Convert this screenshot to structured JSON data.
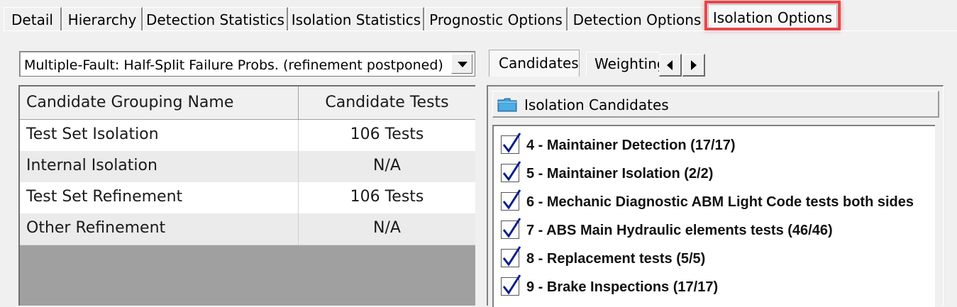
{
  "tabs": [
    {
      "label": "Detail"
    },
    {
      "label": "Hierarchy"
    },
    {
      "label": "Detection Statistics"
    },
    {
      "label": "Isolation Statistics"
    },
    {
      "label": "Prognostic Options"
    },
    {
      "label": "Detection Options"
    },
    {
      "label": "Isolation Options"
    }
  ],
  "active_tab": "Isolation Options",
  "strategy_select": {
    "value": "Multiple-Fault: Half-Split Failure Probs. (refinement postponed)"
  },
  "grid": {
    "columns": [
      "Candidate Grouping Name",
      "Candidate Tests"
    ],
    "rows": [
      {
        "name": "Test Set Isolation",
        "tests": "106 Tests"
      },
      {
        "name": "Internal Isolation",
        "tests": "N/A"
      },
      {
        "name": "Test Set Refinement",
        "tests": "106 Tests"
      },
      {
        "name": "Other Refinement",
        "tests": "N/A"
      }
    ]
  },
  "subtabs": [
    {
      "label": "Candidates"
    },
    {
      "label": "Weighting"
    }
  ],
  "candidates_panel": {
    "title": "Isolation Candidates",
    "items": [
      {
        "label": "4 - Maintainer Detection (17/17)",
        "checked": true
      },
      {
        "label": "5 - Maintainer Isolation (2/2)",
        "checked": true
      },
      {
        "label": "6 - Mechanic Diagnostic ABM Light Code tests both sides",
        "checked": true
      },
      {
        "label": "7 - ABS Main Hydraulic elements tests (46/46)",
        "checked": true
      },
      {
        "label": "8 - Replacement tests (5/5)",
        "checked": true
      },
      {
        "label": "9 - Brake Inspections (17/17)",
        "checked": true
      }
    ]
  },
  "colors": {
    "highlight_border": "#e8464a",
    "checkmark": "#0a1e8c",
    "folder": "#3f9fd9"
  },
  "icons": {
    "folder": "folder-icon",
    "check": "checkmark-icon",
    "dropdown": "chevron-down-icon",
    "scroll_left": "arrow-left-icon",
    "scroll_right": "arrow-right-icon"
  }
}
